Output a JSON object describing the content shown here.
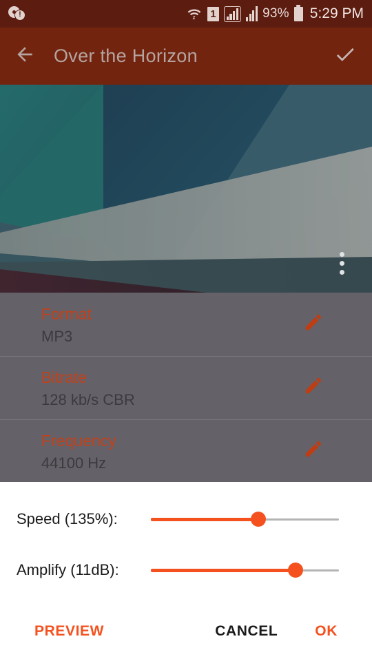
{
  "status_bar": {
    "notification_icon": "disc-warning-icon",
    "icons": [
      "wifi-icon",
      "sim-1-icon",
      "signal-boxed-icon",
      "signal-icon"
    ],
    "sim_label": "1",
    "battery_percent": "93%",
    "battery_icon": "battery-icon",
    "clock": "5:29 PM",
    "background": "#5c1c10"
  },
  "app_bar": {
    "back_icon": "arrow-left-icon",
    "title": "Over the Horizon",
    "confirm_icon": "check-icon",
    "background": "#72240f",
    "title_color": "#b5a49f"
  },
  "album_art": {
    "overflow_icon": "more-vertical-icon",
    "palette": [
      "#0c7d7e",
      "#0a4d6b",
      "#3a6f7f",
      "#56747c",
      "#b9c2c0",
      "#8e9c9b",
      "#3d0f22",
      "#2e4d55"
    ]
  },
  "details": {
    "rows": [
      {
        "label": "Format",
        "value": "MP3",
        "edit_icon": "pencil-icon"
      },
      {
        "label": "Bitrate",
        "value": "128 kb/s CBR",
        "edit_icon": "pencil-icon"
      },
      {
        "label": "Frequency",
        "value": "44100 Hz",
        "edit_icon": "pencil-icon"
      }
    ],
    "label_color": "#c2401a",
    "background": "#646268"
  },
  "dialog": {
    "sliders": [
      {
        "label": "Speed (135%):",
        "value_percent": 57,
        "name": "speed-slider"
      },
      {
        "label": "Amplify (11dB):",
        "value_percent": 77,
        "name": "amplify-slider"
      }
    ],
    "accent_color": "#f4511e",
    "buttons": {
      "preview": "PREVIEW",
      "cancel": "CANCEL",
      "ok": "OK"
    }
  }
}
